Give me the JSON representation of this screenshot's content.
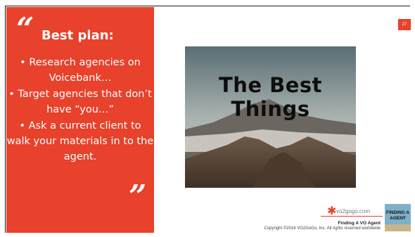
{
  "slide": {
    "page_number": "27",
    "quote_open": "“",
    "quote_close": "”",
    "plan_title": "Best plan:",
    "bullets": [
      "• Research agencies on Voicebank…",
      "• Target agencies that don’t have “you…”",
      "• Ask a current client to walk your materials in to the agent."
    ],
    "photo_caption": "The Best Things",
    "brand_name": "vo2gogo.com",
    "footer_title": "Finding A VO Agent",
    "footer_copyright": "Copyright ©2016 VO2GoGo, Inc. All rights reserved worldwide",
    "logo_line1": "FINDING A",
    "logo_line2": "AGENT"
  },
  "colors": {
    "accent": "#e8412c",
    "background": "#ffffff"
  }
}
